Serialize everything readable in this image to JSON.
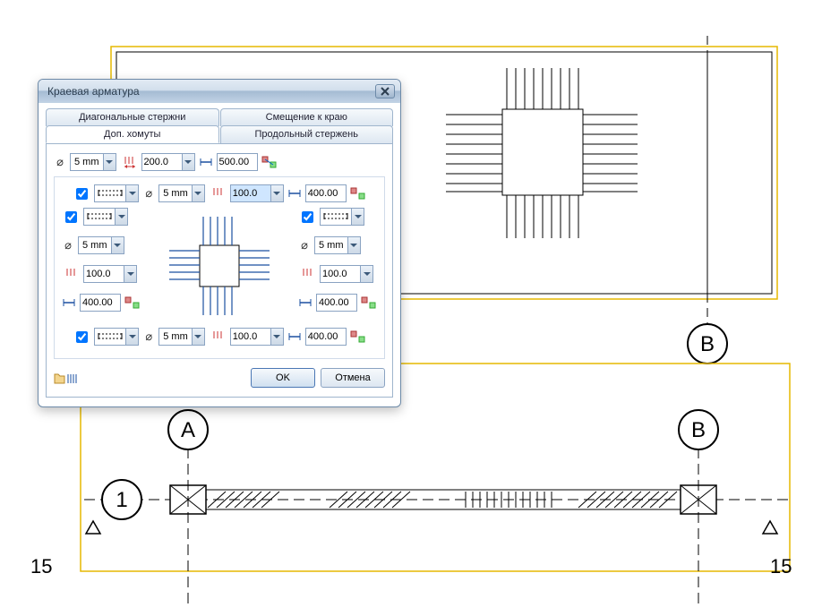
{
  "dialog": {
    "title": "Краевая арматура",
    "tabs": {
      "diagonal": "Диагональные стержни",
      "offset": "Смещение к краю",
      "extra_stirrups": "Доп. хомуты",
      "longitudinal": "Продольный стержень"
    },
    "top_row": {
      "diameter": "5 mm",
      "spacing": "200.0",
      "length": "500.00"
    },
    "top_inner_row": {
      "enabled": true,
      "diameter": "5 mm",
      "spacing": "100.0",
      "length": "400.00"
    },
    "left": {
      "enabled": true,
      "diameter": "5 mm",
      "spacing": "100.0",
      "length": "400.00"
    },
    "right": {
      "enabled": true,
      "diameter": "5 mm",
      "spacing": "100.0",
      "length": "400.00"
    },
    "bottom_inner_row": {
      "enabled": true,
      "diameter": "5 mm",
      "spacing": "100.0",
      "length": "400.00"
    },
    "buttons": {
      "ok": "OK",
      "cancel": "Отмена"
    }
  },
  "cad": {
    "labels": {
      "A": "A",
      "B": "B",
      "marker1": "1",
      "dim15": "15"
    }
  }
}
